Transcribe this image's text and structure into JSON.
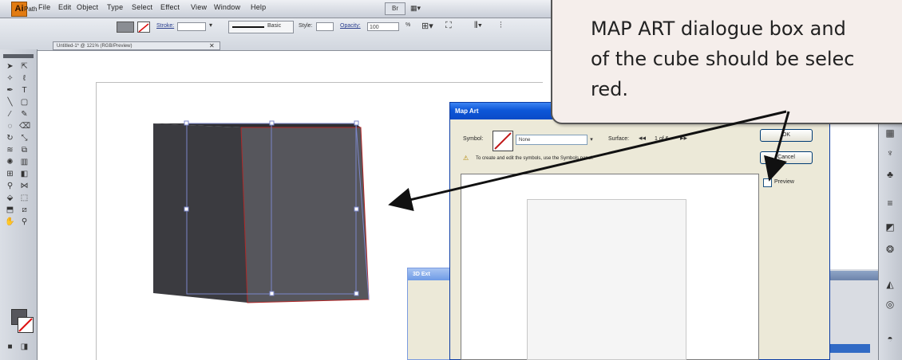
{
  "app": {
    "logo": "Ai"
  },
  "menubar": {
    "items": [
      "File",
      "Edit",
      "Object",
      "Type",
      "Select",
      "Effect",
      "View",
      "Window",
      "Help"
    ],
    "extra": "Br",
    "grid_icon": "grid-icon"
  },
  "controlbar": {
    "path_label": "Path",
    "stroke_label": "Stroke:",
    "brush_value": "Basic",
    "style_label": "Style:",
    "opacity_label": "Opacity:",
    "opacity_value": "100",
    "opacity_unit": "%"
  },
  "document_tab": {
    "title": "Untitled-1* @ 121% (RGB/Preview)"
  },
  "dialog": {
    "title": "Map Art",
    "symbol_label": "Symbol:",
    "symbol_value": "None",
    "surface_label": "Surface:",
    "surface_value": "1 of 6",
    "hint": "To create and edit the symbols, use the Symbols panel.",
    "ok_label": "OK",
    "cancel_label": "Cancel",
    "preview_label": "Preview",
    "preview_checked": false
  },
  "small_dialog": {
    "title": "3D Ext"
  },
  "callout": {
    "lines": [
      "MAP ART dialogue box and",
      "of the cube should be selec",
      "red."
    ]
  },
  "colors": {
    "accent": "#0a4bc7",
    "arrow": "#111111",
    "cube_dark": "#3b3b40",
    "cube_face": "#56565c",
    "selection": "#7b86c8",
    "highlight_edge": "#b02828",
    "ai_orange": "#e27b11"
  }
}
